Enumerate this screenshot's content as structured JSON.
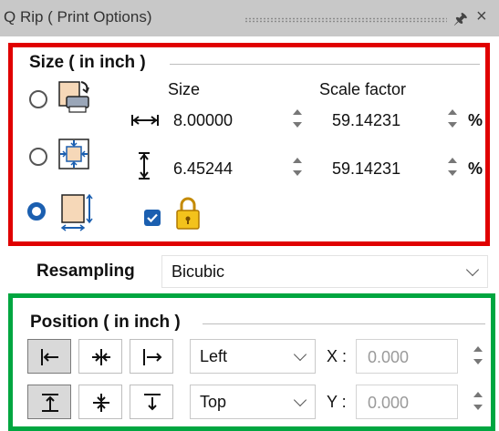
{
  "window": {
    "title": "Q Rip ( Print Options)"
  },
  "size_group": {
    "title": "Size ( in inch )",
    "size_header": "Size",
    "scale_header": "Scale factor",
    "width_value": "8.00000",
    "height_value": "6.45244",
    "scale_x_value": "59.14231",
    "scale_y_value": "59.14231",
    "unit": "%",
    "selected_mode": 3,
    "keep_ratio_checked": true
  },
  "resampling": {
    "label": "Resampling",
    "value": "Bicubic"
  },
  "position_group": {
    "title": "Position ( in inch )",
    "h_align": "Left",
    "v_align": "Top",
    "x_label": "X :",
    "y_label": "Y :",
    "x_value": "0.000",
    "y_value": "0.000"
  },
  "colors": {
    "red_frame": "#e00000",
    "green_frame": "#00a640",
    "accent": "#1b5fb0"
  }
}
